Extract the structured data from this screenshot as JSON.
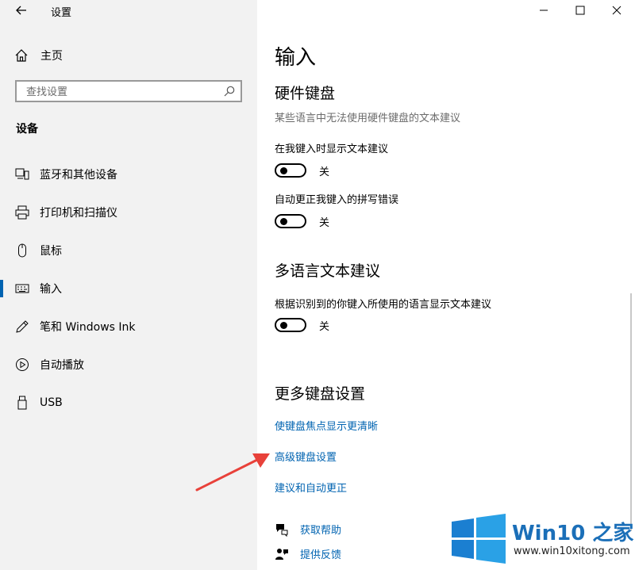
{
  "window": {
    "title": "设置",
    "controls": {
      "minimize": "minimize-icon",
      "maximize": "maximize-icon",
      "close": "close-icon"
    }
  },
  "sidebar": {
    "home_label": "主页",
    "search_placeholder": "查找设置",
    "section_title": "设备",
    "items": [
      {
        "label": "蓝牙和其他设备",
        "icon": "bluetooth-devices-icon"
      },
      {
        "label": "打印机和扫描仪",
        "icon": "printer-icon"
      },
      {
        "label": "鼠标",
        "icon": "mouse-icon"
      },
      {
        "label": "输入",
        "icon": "keyboard-icon",
        "active": true
      },
      {
        "label": "笔和 Windows Ink",
        "icon": "pen-icon"
      },
      {
        "label": "自动播放",
        "icon": "autoplay-icon"
      },
      {
        "label": "USB",
        "icon": "usb-icon"
      }
    ]
  },
  "main": {
    "title": "输入",
    "hardware_keyboard": {
      "heading": "硬件键盘",
      "description": "某些语言中无法使用硬件键盘的文本建议",
      "show_suggestions_label": "在我键入时显示文本建议",
      "show_suggestions_state": "关",
      "autocorrect_label": "自动更正我键入的拼写错误",
      "autocorrect_state": "关"
    },
    "multilingual": {
      "heading": "多语言文本建议",
      "label": "根据识别到的你键入所使用的语言显示文本建议",
      "state": "关"
    },
    "more_keyboard": {
      "heading": "更多键盘设置",
      "links": [
        "使键盘焦点显示更清晰",
        "高级键盘设置",
        "建议和自动更正"
      ]
    },
    "help": {
      "get_help": "获取帮助",
      "feedback": "提供反馈"
    }
  },
  "watermark": {
    "brand": "Win10 之家",
    "url": "www.win10xitong.com",
    "colors": [
      "#1b6fb8",
      "#2aa1e6"
    ]
  },
  "annotation": {
    "arrow_color": "#e8413a",
    "points_to": "高级键盘设置"
  },
  "colors": {
    "accent": "#0063b1",
    "sidebar_bg": "#f2f2f2"
  }
}
